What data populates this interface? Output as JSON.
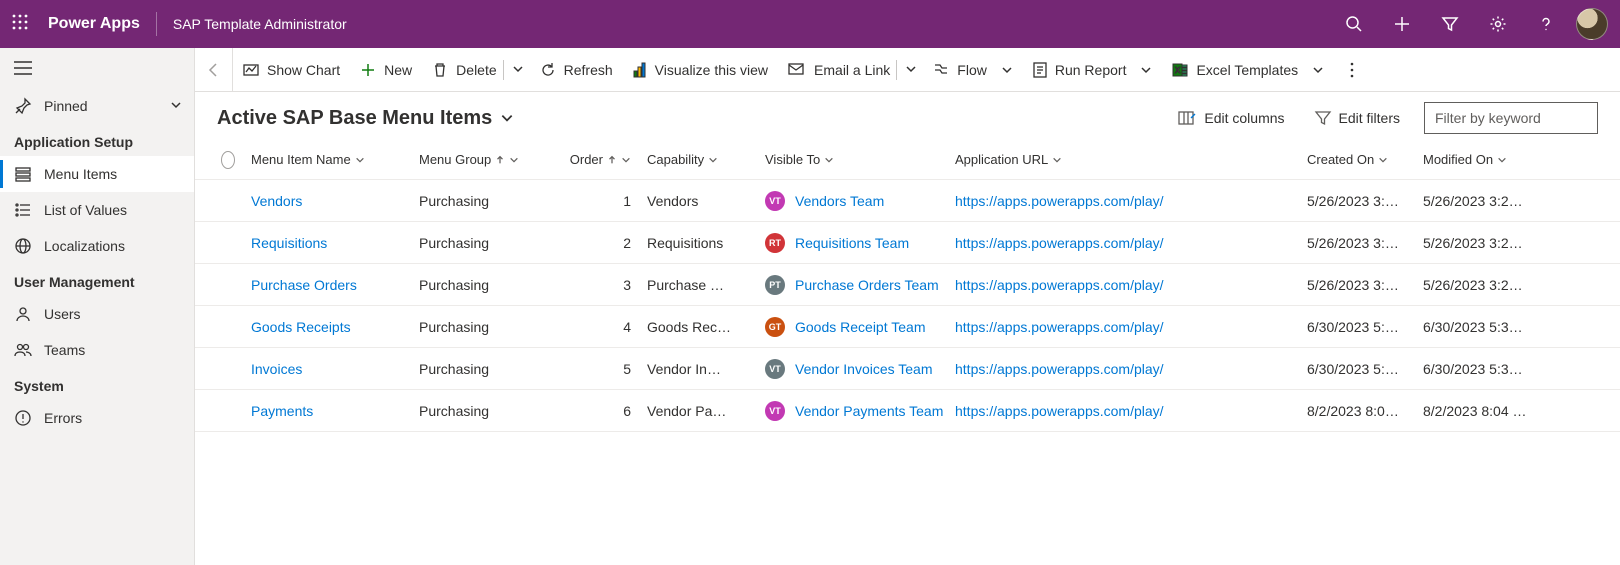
{
  "header": {
    "brand": "Power Apps",
    "app_title": "SAP Template Administrator"
  },
  "sidebar": {
    "pinned": "Pinned",
    "groups": [
      {
        "title": "Application Setup",
        "items": [
          {
            "icon": "menu-items",
            "label": "Menu Items",
            "active": true
          },
          {
            "icon": "list-values",
            "label": "List of Values",
            "active": false
          },
          {
            "icon": "globe",
            "label": "Localizations",
            "active": false
          }
        ]
      },
      {
        "title": "User Management",
        "items": [
          {
            "icon": "user",
            "label": "Users",
            "active": false
          },
          {
            "icon": "team",
            "label": "Teams",
            "active": false
          }
        ]
      },
      {
        "title": "System",
        "items": [
          {
            "icon": "error",
            "label": "Errors",
            "active": false
          }
        ]
      }
    ]
  },
  "commands": {
    "show_chart": "Show Chart",
    "new": "New",
    "delete": "Delete",
    "refresh": "Refresh",
    "visualize": "Visualize this view",
    "email": "Email a Link",
    "flow": "Flow",
    "run_report": "Run Report",
    "excel": "Excel Templates"
  },
  "view": {
    "title": "Active SAP Base Menu Items",
    "edit_columns": "Edit columns",
    "edit_filters": "Edit filters",
    "filter_placeholder": "Filter by keyword"
  },
  "grid": {
    "columns": {
      "name": "Menu Item Name",
      "group": "Menu Group",
      "order": "Order",
      "capability": "Capability",
      "visible": "Visible To",
      "url": "Application URL",
      "created": "Created On",
      "modified": "Modified On"
    },
    "rows": [
      {
        "name": "Vendors",
        "group": "Purchasing",
        "order": "1",
        "capability": "Vendors",
        "visible_initials": "VT",
        "visible_color": "#c239b3",
        "visible_team": "Vendors Team",
        "url": "https://apps.powerapps.com/play/",
        "created": "5/26/2023 3:…",
        "modified": "5/26/2023 3:2…"
      },
      {
        "name": "Requisitions",
        "group": "Purchasing",
        "order": "2",
        "capability": "Requisitions",
        "visible_initials": "RT",
        "visible_color": "#d13438",
        "visible_team": "Requisitions Team",
        "url": "https://apps.powerapps.com/play/",
        "created": "5/26/2023 3:…",
        "modified": "5/26/2023 3:2…"
      },
      {
        "name": "Purchase Orders",
        "group": "Purchasing",
        "order": "3",
        "capability": "Purchase …",
        "visible_initials": "PT",
        "visible_color": "#69797e",
        "visible_team": "Purchase Orders Team",
        "url": "https://apps.powerapps.com/play/",
        "created": "5/26/2023 3:…",
        "modified": "5/26/2023 3:2…"
      },
      {
        "name": "Goods Receipts",
        "group": "Purchasing",
        "order": "4",
        "capability": "Goods Rec…",
        "visible_initials": "GT",
        "visible_color": "#ca5010",
        "visible_team": "Goods Receipt Team",
        "url": "https://apps.powerapps.com/play/",
        "created": "6/30/2023 5:…",
        "modified": "6/30/2023 5:3…"
      },
      {
        "name": "Invoices",
        "group": "Purchasing",
        "order": "5",
        "capability": "Vendor In…",
        "visible_initials": "VT",
        "visible_color": "#69797e",
        "visible_team": "Vendor Invoices Team",
        "url": "https://apps.powerapps.com/play/",
        "created": "6/30/2023 5:…",
        "modified": "6/30/2023 5:3…"
      },
      {
        "name": "Payments",
        "group": "Purchasing",
        "order": "6",
        "capability": "Vendor Pa…",
        "visible_initials": "VT",
        "visible_color": "#c239b3",
        "visible_team": "Vendor Payments Team",
        "url": "https://apps.powerapps.com/play/",
        "created": "8/2/2023 8:0…",
        "modified": "8/2/2023 8:04 …"
      }
    ]
  }
}
